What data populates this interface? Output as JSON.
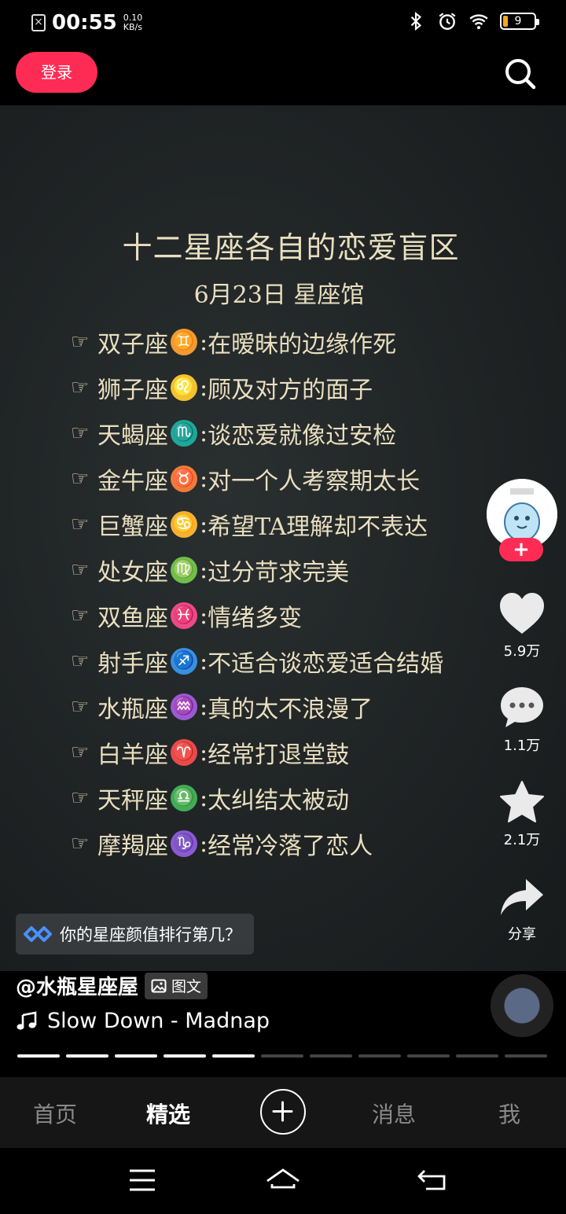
{
  "status_bar": {
    "time": "00:55",
    "net_speed_value": "0.10",
    "net_speed_unit": "KB/s",
    "battery": "9",
    "icons": [
      "sim-off-icon",
      "bluetooth-icon",
      "alarm-icon",
      "wifi-icon",
      "battery-icon"
    ]
  },
  "top_nav": {
    "login_label": "登录",
    "search_icon": "search-icon"
  },
  "post": {
    "title": "十二星座各自的恋爱盲区",
    "subtitle": "6月23日   星座馆",
    "items": [
      {
        "sign": "双子座",
        "symbol": "♊",
        "color": "#f29a32",
        "text": "在暧昧的边缘作死"
      },
      {
        "sign": "狮子座",
        "symbol": "♌",
        "color": "#f2c230",
        "text": "顾及对方的面子"
      },
      {
        "sign": "天蝎座",
        "symbol": "♏",
        "color": "#1fa89a",
        "text": "谈恋爱就像过安检"
      },
      {
        "sign": "金牛座",
        "symbol": "♉",
        "color": "#f07a3a",
        "text": "对一个人考察期太长"
      },
      {
        "sign": "巨蟹座",
        "symbol": "♋",
        "color": "#f2b233",
        "text": "希望TA理解却不表达"
      },
      {
        "sign": "处女座",
        "symbol": "♍",
        "color": "#6fbf4a",
        "text": "过分苛求完美"
      },
      {
        "sign": "双鱼座",
        "symbol": "♓",
        "color": "#ec4a86",
        "text": "情绪多变"
      },
      {
        "sign": "射手座",
        "symbol": "♐",
        "color": "#3a8fe0",
        "text": "不适合谈恋爱适合结婚"
      },
      {
        "sign": "水瓶座",
        "symbol": "♒",
        "color": "#9a5ad0",
        "text": "真的太不浪漫了"
      },
      {
        "sign": "白羊座",
        "symbol": "♈",
        "color": "#ea4a4a",
        "text": "经常打退堂鼓"
      },
      {
        "sign": "天秤座",
        "symbol": "♎",
        "color": "#3fae55",
        "text": "太纠结太被动"
      },
      {
        "sign": "摩羯座",
        "symbol": "♑",
        "color": "#8a5ad0",
        "text": "经常冷落了恋人"
      }
    ]
  },
  "actions": {
    "likes": "5.9万",
    "comments": "1.1万",
    "favorites": "2.1万",
    "share_label": "分享",
    "follow_label": "+"
  },
  "link_chip": {
    "text": "你的星座颜值排行第几？"
  },
  "author": {
    "name": "@水瓶星座屋",
    "badge": "图文"
  },
  "music": {
    "song": "Slow Down - Madnap"
  },
  "progress": {
    "total": 11,
    "active": 5
  },
  "tabbar": {
    "tabs": [
      "首页",
      "精选",
      "消息",
      "我"
    ],
    "active": "精选"
  },
  "colors": {
    "accent": "#fe2c55",
    "text_gold": "#e9dfbf"
  }
}
